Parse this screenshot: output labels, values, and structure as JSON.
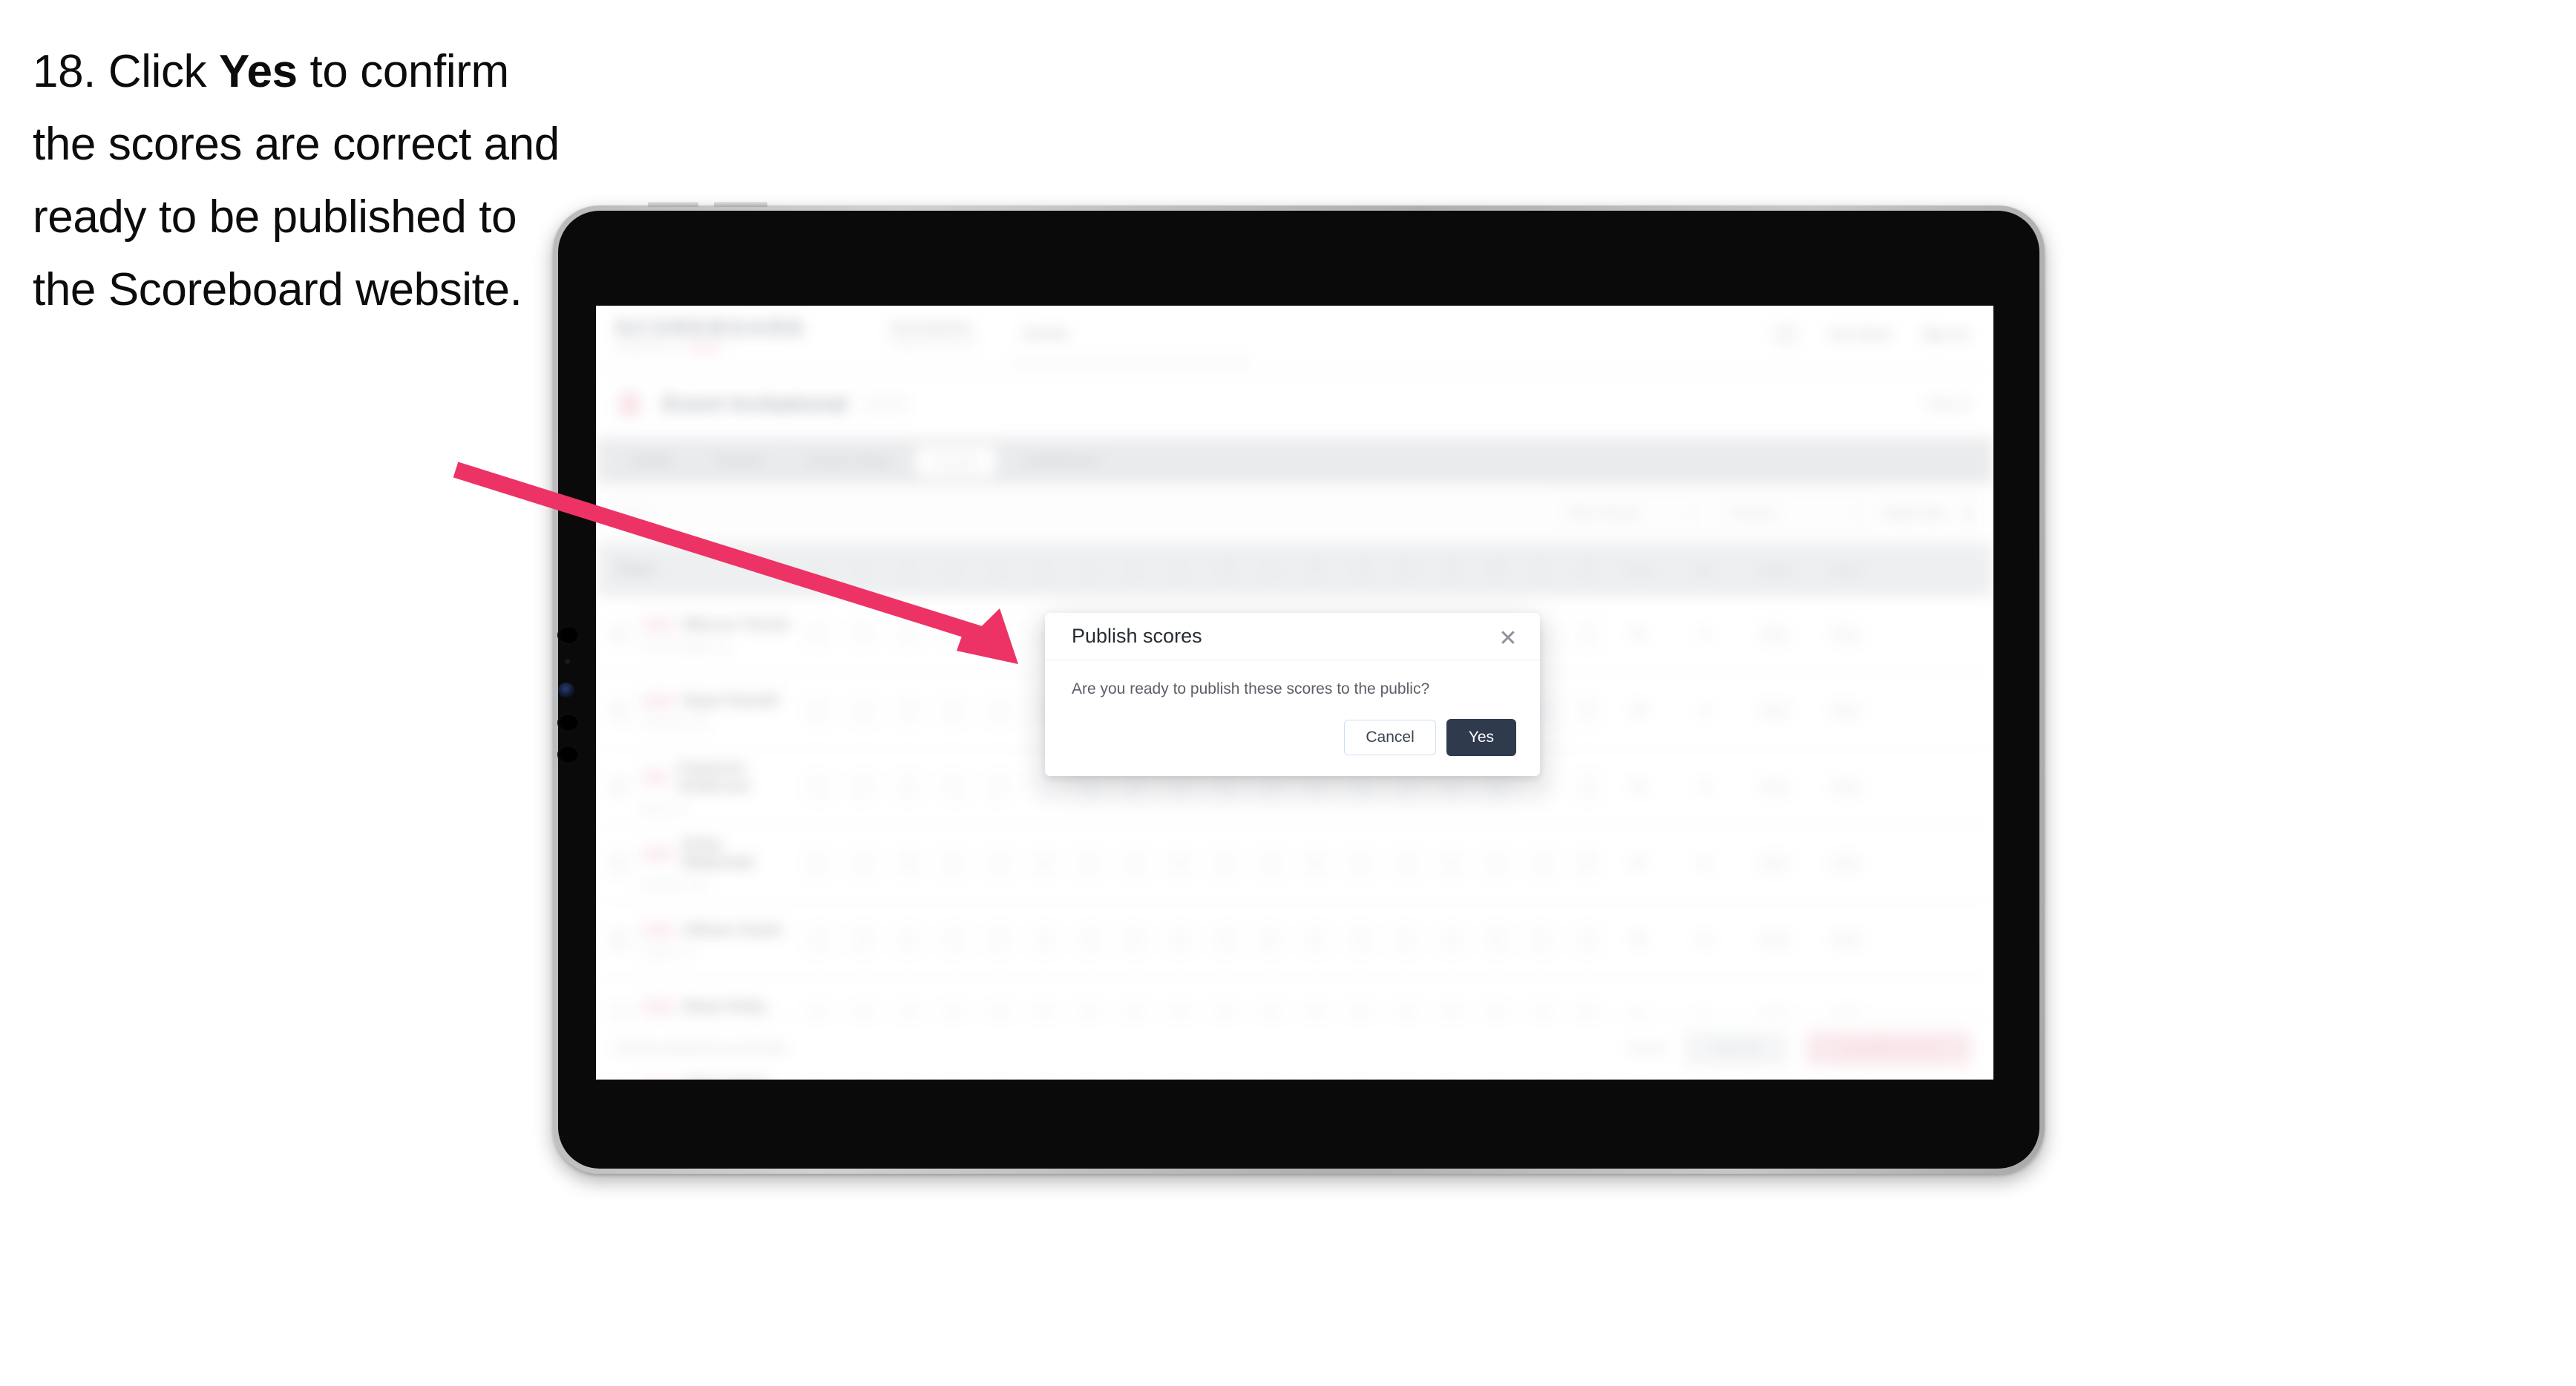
{
  "caption": {
    "number": "18.",
    "text_before": "Click ",
    "emphasis": "Yes",
    "text_after": " to confirm the scores are correct and ready to be published to the Scoreboard website."
  },
  "annotation": {
    "arrow_color": "#ED3365",
    "points_to": "yes-button"
  },
  "device": {
    "type": "tablet",
    "frame_color": "#bcbdbf",
    "bezel_color": "#0a0a0a"
  },
  "modal": {
    "title": "Publish scores",
    "message": "Are you ready to publish these scores to the public?",
    "close_icon": "close-icon",
    "cancel_label": "Cancel",
    "yes_label": "Yes",
    "yes_color": "#2F3A4D",
    "cancel_border_color": "#CFE0F2"
  },
  "app": {
    "brand": {
      "word": "SCOREBOARD",
      "sub": "POWERED BY",
      "sub_accent": "PDGA"
    },
    "header_nav": [
      {
        "label": "Tournaments",
        "sub": "Manage & create events"
      },
      {
        "label": "Events",
        "sub": ""
      }
    ],
    "header_right": [
      {
        "label": "Your Name"
      },
      {
        "label": "Sign out"
      }
    ],
    "event": {
      "icon": "disc-icon",
      "name": "Event Invitational",
      "tag": "2024",
      "right_link": "View all"
    },
    "tabs": [
      {
        "label": "Details",
        "active": false
      },
      {
        "label": "Rounds",
        "active": false
      },
      {
        "label": "Course Setup",
        "active": false
      },
      {
        "label": "Results",
        "active": true
      },
      {
        "label": "Leaderboard",
        "active": false
      }
    ],
    "filters": {
      "search_icon": "search-icon",
      "division_select": "Filter division",
      "round_select": "Round 1",
      "reset_link": "Reset view",
      "gear_icon": "gear-icon"
    },
    "table": {
      "player_header": "Player",
      "hole_headers": [
        {
          "n": "1",
          "s": "Par 3"
        },
        {
          "n": "2",
          "s": "Par 4"
        },
        {
          "n": "3",
          "s": "Par 3"
        },
        {
          "n": "4",
          "s": "Par 3"
        },
        {
          "n": "5",
          "s": "Par 4"
        },
        {
          "n": "6",
          "s": "Par 3"
        },
        {
          "n": "7",
          "s": "Par 3"
        },
        {
          "n": "8",
          "s": "Par 5"
        },
        {
          "n": "9",
          "s": "Par 3"
        },
        {
          "n": "10",
          "s": "Par 3"
        },
        {
          "n": "11",
          "s": "Par 4"
        },
        {
          "n": "12",
          "s": "Par 3"
        },
        {
          "n": "13",
          "s": "Par 3"
        },
        {
          "n": "14",
          "s": "Par 4"
        },
        {
          "n": "15",
          "s": "Par 3"
        },
        {
          "n": "16",
          "s": "Par 3"
        },
        {
          "n": "17",
          "s": "Par 4"
        },
        {
          "n": "18",
          "s": "Par 3"
        }
      ],
      "summary_headers": [
        {
          "label": "Total"
        },
        {
          "label": "Par"
        },
        {
          "label": "Rating"
        },
        {
          "label": "Status"
        }
      ],
      "rows": [
        {
          "badge": "MPO",
          "name": "Marcus Turner",
          "sub": "Grand Rapids, MI",
          "scores": [
            "3",
            "4",
            "3",
            "3",
            "4",
            "3",
            "3",
            "5",
            "3",
            "3",
            "4",
            "3",
            "3",
            "4",
            "3",
            "3",
            "4",
            "3"
          ],
          "total": "60",
          "par": "-2",
          "rating": "1012",
          "status": "Final"
        },
        {
          "badge": "MPO",
          "name": "Ryan Parnell",
          "sub": "Charlotte, NC",
          "scores": [
            "3",
            "3",
            "2",
            "3",
            "4",
            "3",
            "4",
            "4",
            "3",
            "3",
            "4",
            "4",
            "3",
            "4",
            "3",
            "3",
            "4",
            "3"
          ],
          "total": "58",
          "par": "-4",
          "rating": "1028",
          "status": "Final"
        },
        {
          "badge": "MPO",
          "name": "Cameron Anderson",
          "sub": "Boise, ID",
          "scores": [
            "4",
            "3",
            "3",
            "2",
            "4",
            "3",
            "3",
            "5",
            "3",
            "4",
            "4",
            "3",
            "3",
            "4",
            "3",
            "3",
            "4",
            "3"
          ],
          "total": "59",
          "par": "-3",
          "rating": "1020",
          "status": "Final"
        },
        {
          "badge": "FPO",
          "name": "Erika Malachuk",
          "sub": "Portland, OR",
          "scores": [
            "3",
            "4",
            "3",
            "3",
            "5",
            "3",
            "4",
            "5",
            "3",
            "3",
            "4",
            "4",
            "3",
            "4",
            "4",
            "3",
            "5",
            "3"
          ],
          "total": "64",
          "par": "+2",
          "rating": "968",
          "status": "Final"
        },
        {
          "badge": "FPO",
          "name": "Allison Grant",
          "sub": "Austin, TX",
          "scores": [
            "4",
            "4",
            "3",
            "3",
            "4",
            "4",
            "3",
            "5",
            "4",
            "3",
            "5",
            "4",
            "3",
            "4",
            "3",
            "4",
            "4",
            "3"
          ],
          "total": "66",
          "par": "+4",
          "rating": "954",
          "status": "Final"
        },
        {
          "badge": "MA1",
          "name": "Dean Kirby",
          "sub": "Nashville, TN",
          "scores": [
            "3",
            "4",
            "4",
            "3",
            "4",
            "3",
            "3",
            "5",
            "3",
            "4",
            "4",
            "3",
            "4",
            "4",
            "3",
            "3",
            "4",
            "3"
          ],
          "total": "62",
          "par": "0",
          "rating": "1001",
          "status": "Final"
        },
        {
          "badge": "MA1",
          "name": "Nate Bailey",
          "sub": "Columbus, OH",
          "scores": [
            "4",
            "4",
            "3",
            "3",
            "4",
            "3",
            "4",
            "5",
            "3",
            "3",
            "4",
            "4",
            "3",
            "5",
            "3",
            "3",
            "4",
            "3"
          ],
          "total": "63",
          "par": "+1",
          "rating": "986",
          "status": "Final"
        }
      ]
    },
    "footer": {
      "note": "Results published successfully",
      "text_button": "Cancel",
      "grey_button": "Save all",
      "pink_button": "Unpublish scores"
    }
  }
}
